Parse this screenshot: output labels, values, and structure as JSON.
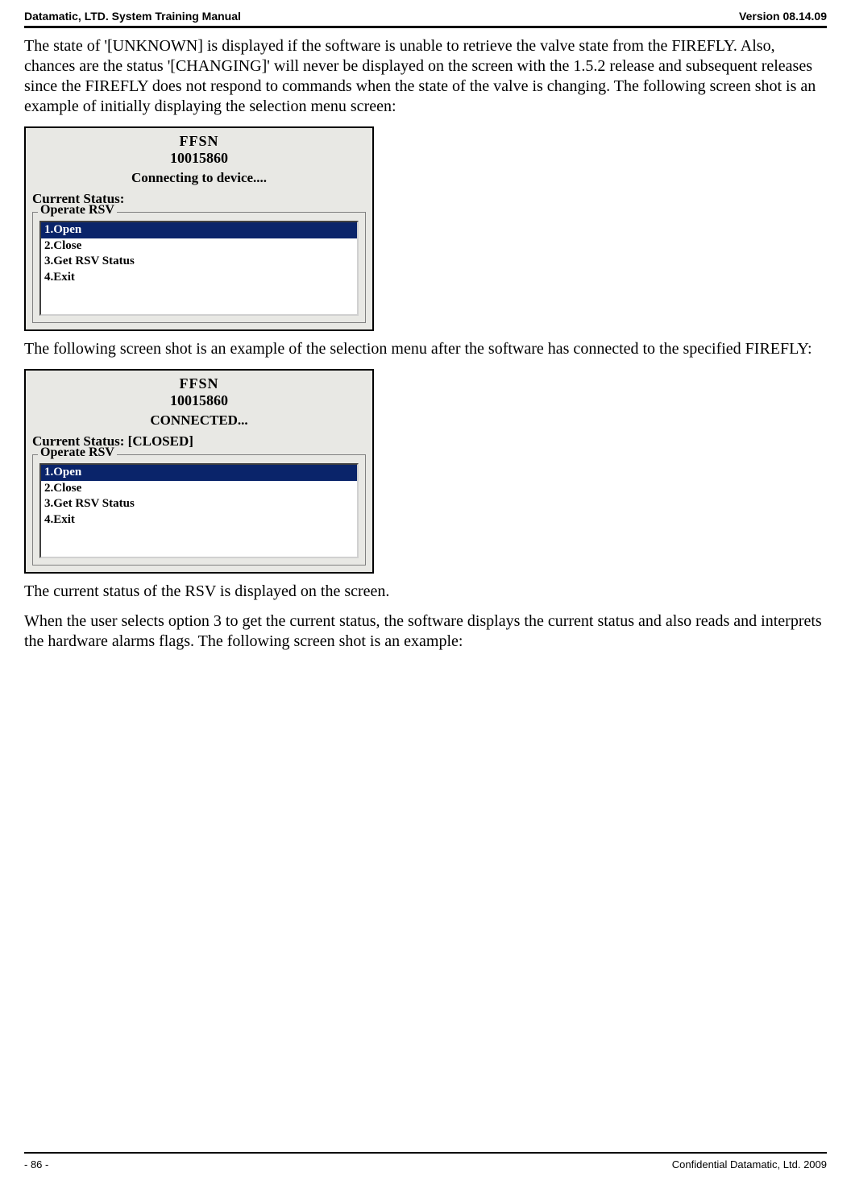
{
  "header": {
    "left": "Datamatic, LTD. System Training  Manual",
    "right": "Version 08.14.09"
  },
  "para1": "The state of '[UNKNOWN] is displayed if the software is unable to retrieve the valve state from the FIREFLY.  Also, chances are the status '[CHANGING]' will never be displayed on the screen with the 1.5.2 release and subsequent releases since the FIREFLY does not respond to commands when the state of the valve is changing.  The following screen shot is an example of initially displaying the selection menu screen:",
  "screenshot1": {
    "title": "FFSN",
    "serial": "10015860",
    "statusMsg": "Connecting to device....",
    "currentStatus": "Current Status:",
    "legend": "Operate RSV",
    "items": [
      "1.Open",
      "2.Close",
      "3.Get RSV Status",
      "4.Exit"
    ]
  },
  "para2": "The following screen shot is an example of the selection menu after the software has connected to the specified FIREFLY:",
  "screenshot2": {
    "title": "FFSN",
    "serial": "10015860",
    "statusMsg": "CONNECTED...",
    "currentStatus": "Current Status: [CLOSED]",
    "legend": "Operate RSV",
    "items": [
      "1.Open",
      "2.Close",
      "3.Get RSV Status",
      "4.Exit"
    ]
  },
  "para3": "The current status of the RSV is displayed on the screen.",
  "para4": "When the user selects option 3 to get the current status, the software displays the current status and also reads and interprets the hardware alarms flags.  The following screen shot is an example:",
  "footer": {
    "left": "- 86 -",
    "right": "Confidential Datamatic, Ltd. 2009"
  }
}
